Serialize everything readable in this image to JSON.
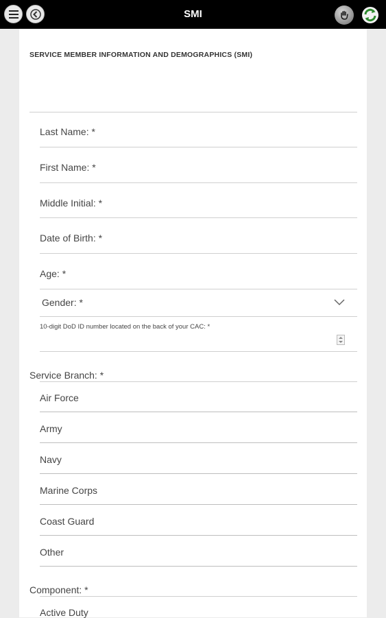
{
  "header": {
    "title": "SMI"
  },
  "form": {
    "section_title": "SERVICE MEMBER INFORMATION AND DEMOGRAPHICS (SMI)",
    "fields": {
      "last_name": "Last Name: *",
      "first_name": "First Name: *",
      "middle_initial": "Middle Initial: *",
      "date_of_birth": "Date of Birth: *",
      "age": "Age: *",
      "gender": "Gender: *",
      "dod_id": "10-digit DoD ID number located on the back of your CAC: *"
    },
    "service_branch": {
      "label": "Service Branch: *",
      "options": [
        "Air Force",
        "Army",
        "Navy",
        "Marine Corps",
        "Coast Guard",
        "Other"
      ]
    },
    "component": {
      "label": "Component: *",
      "options": [
        "Active Duty"
      ]
    }
  },
  "icons": {
    "menu": "menu-icon",
    "back": "back-arrow-icon",
    "hand": "hand-icon",
    "refresh": "refresh-icon"
  }
}
